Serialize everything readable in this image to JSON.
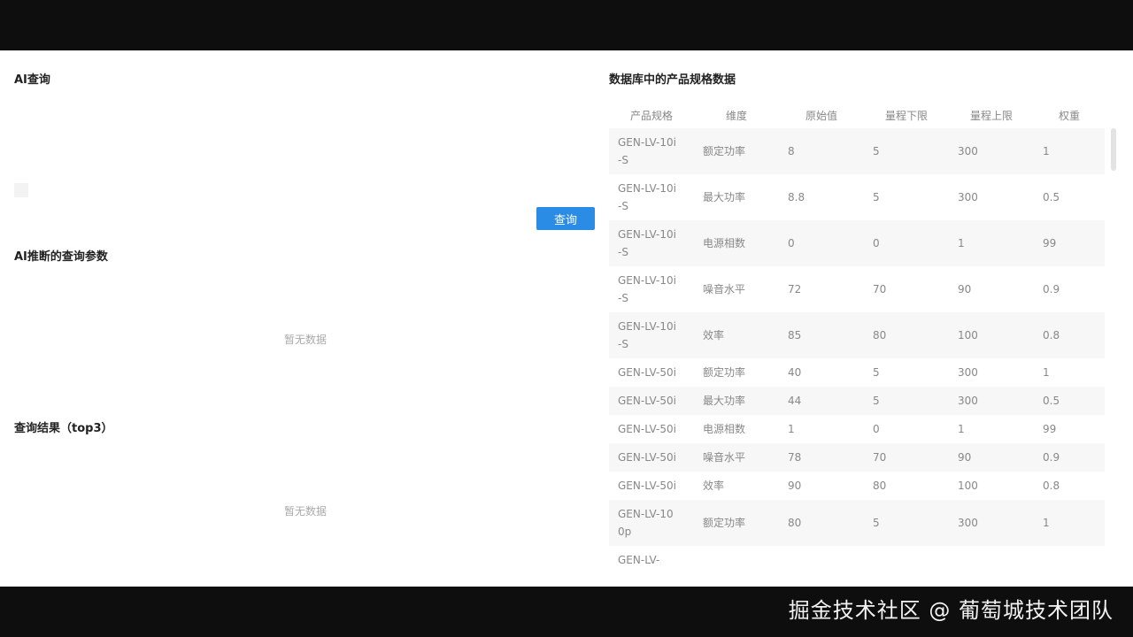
{
  "query_section": {
    "title": "AI查询",
    "button_label": "查询"
  },
  "params_section": {
    "title": "AI推断的查询参数",
    "empty_text": "暂无数据"
  },
  "results_section": {
    "title": "查询结果（top3）",
    "empty_text": "暂无数据"
  },
  "spec_section": {
    "title": "数据库中的产品规格数据",
    "columns": [
      "产品规格",
      "维度",
      "原始值",
      "量程下限",
      "量程上限",
      "权重"
    ],
    "rows": [
      [
        "GEN-LV-10i-S",
        "额定功率",
        "8",
        "5",
        "300",
        "1"
      ],
      [
        "GEN-LV-10i-S",
        "最大功率",
        "8.8",
        "5",
        "300",
        "0.5"
      ],
      [
        "GEN-LV-10i-S",
        "电源相数",
        "0",
        "0",
        "1",
        "99"
      ],
      [
        "GEN-LV-10i-S",
        "噪音水平",
        "72",
        "70",
        "90",
        "0.9"
      ],
      [
        "GEN-LV-10i-S",
        "效率",
        "85",
        "80",
        "100",
        "0.8"
      ],
      [
        "GEN-LV-50i",
        "额定功率",
        "40",
        "5",
        "300",
        "1"
      ],
      [
        "GEN-LV-50i",
        "最大功率",
        "44",
        "5",
        "300",
        "0.5"
      ],
      [
        "GEN-LV-50i",
        "电源相数",
        "1",
        "0",
        "1",
        "99"
      ],
      [
        "GEN-LV-50i",
        "噪音水平",
        "78",
        "70",
        "90",
        "0.9"
      ],
      [
        "GEN-LV-50i",
        "效率",
        "90",
        "80",
        "100",
        "0.8"
      ],
      [
        "GEN-LV-100p",
        "额定功率",
        "80",
        "5",
        "300",
        "1"
      ],
      [
        "GEN-LV-",
        "",
        "",
        "",
        "",
        ""
      ]
    ]
  },
  "watermark": "掘金技术社区 @ 葡萄城技术团队"
}
